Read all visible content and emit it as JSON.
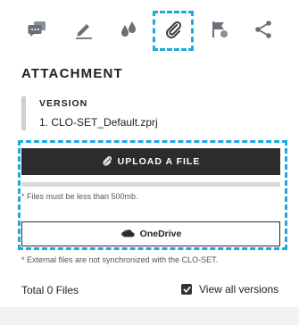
{
  "toolbar": {
    "icons": [
      "comments-icon",
      "edit-icon",
      "color-drops-icon",
      "attachment-icon",
      "flag-icon",
      "share-icon"
    ],
    "active_icon": "attachment-icon"
  },
  "attachment": {
    "title": "ATTACHMENT",
    "version_label": "VERSION",
    "version_file": "1. CLO-SET_Default.zprj",
    "upload_button": "UPLOAD A FILE",
    "size_note": "* Files must be less than 500mb.",
    "onedrive_button": "OneDrive",
    "external_note": "* External files are not synchronized with the CLO-SET.",
    "total_files": "Total 0 Files",
    "view_all_label": "View all versions",
    "view_all_checked": true
  },
  "colors": {
    "accent": "#1fa8e0",
    "button_dark": "#2c2c2e",
    "icon_gray": "#6b6f78"
  }
}
